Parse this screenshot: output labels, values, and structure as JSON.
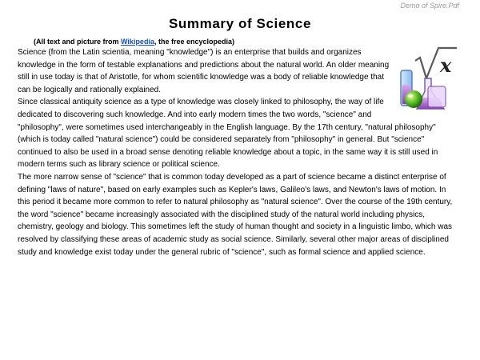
{
  "watermark": "Demo of Spire.Pdf",
  "title": "Summary of Science",
  "credit": {
    "prefix": "(All text and picture from ",
    "link": "Wikipedia",
    "suffix": ", the free encyclopedia)"
  },
  "logo": {
    "icon": "science-flask-root-x-icon",
    "label": "x"
  },
  "paragraphs": [
    "Science (from the Latin scientia, meaning \"knowledge\") is an enterprise that builds and organizes knowledge in the form of testable explanations and predictions about the natural world. An older meaning still in use today is that of Aristotle, for whom scientific knowledge was a body of reliable knowledge that can be logically and rationally explained.",
    "Since classical antiquity science as a type of knowledge was closely linked to philosophy, the way of life dedicated to discovering such knowledge. And into early modern times the two words, \"science\" and \"philosophy\", were sometimes used interchangeably in the English language. By the 17th century, \"natural philosophy\" (which is today called \"natural science\") could be considered separately from \"philosophy\" in general. But \"science\" continued to also be used in a broad sense denoting reliable knowledge about a topic, in the same way it is still used in modern terms such as library science or political science.",
    "The more narrow sense of \"science\" that is common today developed as a part of science became a distinct enterprise of defining \"laws of nature\", based on early examples such as Kepler's laws, Galileo's laws, and Newton's laws of motion. In this period it became more common to refer to natural philosophy as \"natural science\". Over the course of the 19th century, the word \"science\" became increasingly associated with the disciplined study of the natural world including physics, chemistry, geology and biology. This sometimes left the study of human thought and society in a linguistic limbo, which was resolved by classifying these areas of academic study as social science. Similarly, several other major areas of disciplined study and knowledge exist today under the general rubric of \"science\", such as formal science and applied science."
  ]
}
